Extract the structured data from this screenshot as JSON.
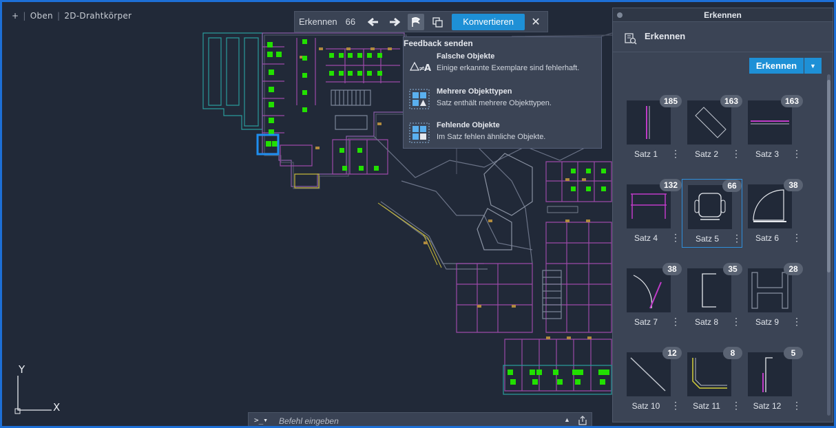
{
  "viewport": {
    "plus": "+",
    "view": "Oben",
    "style": "2D-Drahtkörper"
  },
  "ucs": {
    "y": "Y",
    "x": "X"
  },
  "detect_toolbar": {
    "label": "Erkennen",
    "count": "66",
    "convert_label": "Konvertieren",
    "close": "✕"
  },
  "feedback": {
    "title": "Feedback senden",
    "items": [
      {
        "title": "Falsche Objekte",
        "desc": "Einige erkannte Exemplare sind fehlerhaft.",
        "icon": "false-objects-icon"
      },
      {
        "title": "Mehrere Objekttypen",
        "desc": "Satz enthält mehrere Objekttypen.",
        "icon": "multiple-types-icon"
      },
      {
        "title": "Fehlende Objekte",
        "desc": "Im Satz fehlen ähnliche Objekte.",
        "icon": "missing-objects-icon"
      }
    ]
  },
  "panel": {
    "window_title": "Erkennen",
    "header": "Erkennen",
    "detect_button": "Erkennen",
    "sets": [
      {
        "label": "Satz 1",
        "count": "185",
        "icon": "vertical-line-icon"
      },
      {
        "label": "Satz 2",
        "count": "163",
        "icon": "rotated-rectangle-icon"
      },
      {
        "label": "Satz 3",
        "count": "163",
        "icon": "horizontal-bar-icon"
      },
      {
        "label": "Satz 4",
        "count": "132",
        "icon": "table-icon"
      },
      {
        "label": "Satz 5",
        "count": "66",
        "icon": "chair-icon",
        "selected": true
      },
      {
        "label": "Satz 6",
        "count": "38",
        "icon": "door-swing-icon"
      },
      {
        "label": "Satz 7",
        "count": "38",
        "icon": "arc-door-icon"
      },
      {
        "label": "Satz 8",
        "count": "35",
        "icon": "bracket-icon"
      },
      {
        "label": "Satz 9",
        "count": "28",
        "icon": "h-shape-icon"
      },
      {
        "label": "Satz 10",
        "count": "12",
        "icon": "diagonal-line-icon"
      },
      {
        "label": "Satz 11",
        "count": "8",
        "icon": "angled-line-icon"
      },
      {
        "label": "Satz 12",
        "count": "5",
        "icon": "corner-line-icon"
      }
    ]
  },
  "command": {
    "prompt": ">_▾",
    "placeholder": "Befehl eingeben"
  },
  "colors": {
    "accent": "#1e90d6",
    "detected": "#22e000",
    "wall_magenta": "#b23fb5",
    "wall_teal": "#2a9b9b"
  }
}
